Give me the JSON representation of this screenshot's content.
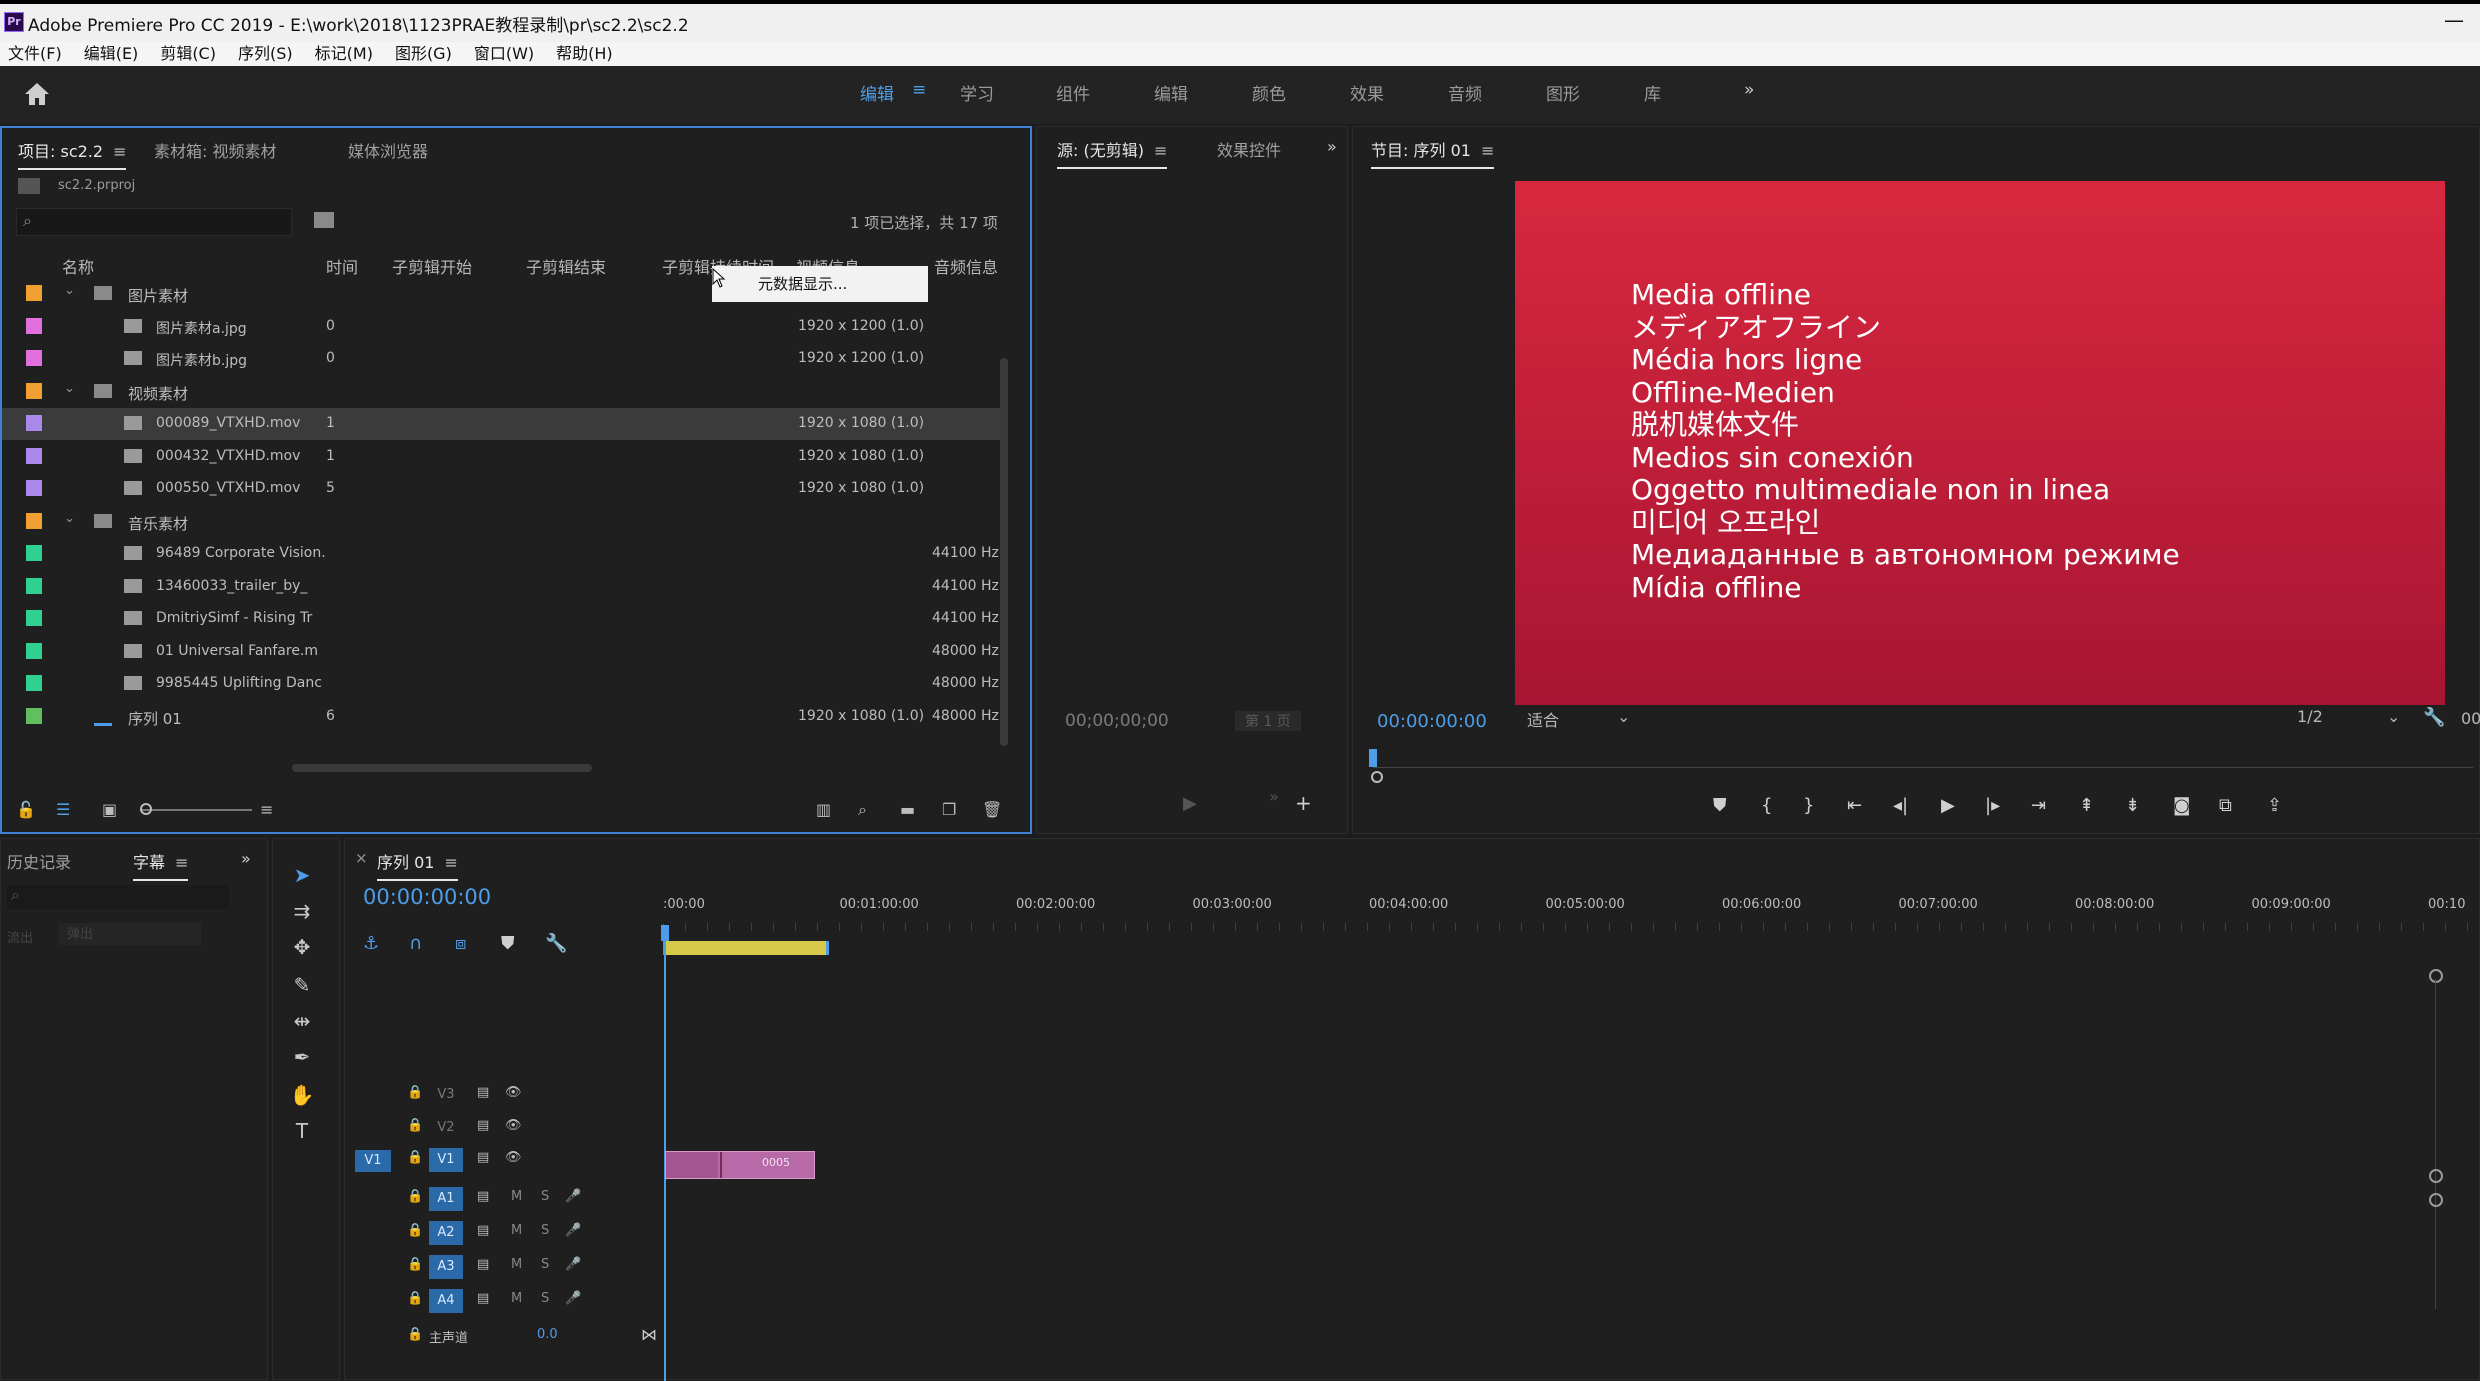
{
  "window": {
    "title": "Adobe Premiere Pro CC 2019 - E:\\work\\2018\\1123PRAE教程录制\\pr\\sc2.2\\sc2.2",
    "app_icon": "Pr"
  },
  "menu": [
    "文件(F)",
    "编辑(E)",
    "剪辑(C)",
    "序列(S)",
    "标记(M)",
    "图形(G)",
    "窗口(W)",
    "帮助(H)"
  ],
  "workspaces": [
    "编辑",
    "学习",
    "组件",
    "编辑",
    "颜色",
    "效果",
    "音频",
    "图形",
    "库"
  ],
  "project": {
    "tabs": [
      "项目: sc2.2",
      "素材箱: 视频素材",
      "媒体浏览器"
    ],
    "file": "sc2.2.prproj",
    "search_placeholder": "",
    "selection_count": "1 项已选择，共 17 项",
    "columns": [
      "名称",
      "时间",
      "子剪辑开始",
      "子剪辑结束",
      "子剪辑持续时间",
      "视频信息",
      "音频信息"
    ],
    "tooltip": "元数据显示...",
    "rows": [
      {
        "type": "folder",
        "name": "图片素材",
        "color": "#f0a030",
        "time": "",
        "video": "",
        "audio": ""
      },
      {
        "type": "file",
        "name": "图片素材a.jpg",
        "color": "#e070e0",
        "time": "0",
        "video": "1920 x 1200 (1.0)",
        "audio": ""
      },
      {
        "type": "file",
        "name": "图片素材b.jpg",
        "color": "#e070e0",
        "time": "0",
        "video": "1920 x 1200 (1.0)",
        "audio": ""
      },
      {
        "type": "folder",
        "name": "视频素材",
        "color": "#f0a030",
        "time": "",
        "video": "",
        "audio": ""
      },
      {
        "type": "file",
        "name": "000089_VTXHD.mov",
        "color": "#a888e8",
        "time": "1",
        "video": "1920 x 1080 (1.0)",
        "audio": "",
        "selected": true
      },
      {
        "type": "file",
        "name": "000432_VTXHD.mov",
        "color": "#a888e8",
        "time": "1",
        "video": "1920 x 1080 (1.0)",
        "audio": ""
      },
      {
        "type": "file",
        "name": "000550_VTXHD.mov",
        "color": "#a888e8",
        "time": "5",
        "video": "1920 x 1080 (1.0)",
        "audio": ""
      },
      {
        "type": "folder",
        "name": "音乐素材",
        "color": "#f0a030",
        "time": "",
        "video": "",
        "audio": ""
      },
      {
        "type": "file",
        "name": "96489 Corporate Vision.",
        "color": "#30d090",
        "time": "",
        "video": "",
        "audio": "44100 Hz"
      },
      {
        "type": "file",
        "name": "13460033_trailer_by_",
        "color": "#30d090",
        "time": "",
        "video": "",
        "audio": "44100 Hz"
      },
      {
        "type": "file",
        "name": "DmitriySimf - Rising Tr",
        "color": "#30d090",
        "time": "",
        "video": "",
        "audio": "44100 Hz"
      },
      {
        "type": "file",
        "name": "01 Universal Fanfare.m",
        "color": "#30d090",
        "time": "",
        "video": "",
        "audio": "48000 Hz"
      },
      {
        "type": "file",
        "name": "9985445 Uplifting Danc",
        "color": "#30d090",
        "time": "",
        "video": "",
        "audio": "48000 Hz"
      },
      {
        "type": "sequence",
        "name": "序列 01",
        "color": "#60c060",
        "time": "6",
        "video": "1920 x 1080 (1.0)",
        "audio": "48000 Hz"
      }
    ]
  },
  "source": {
    "tabs": [
      "源: (无剪辑)",
      "效果控件"
    ],
    "timecode": "00;00;00;00",
    "page": "第 1 页"
  },
  "program": {
    "tab": "节目: 序列 01",
    "offline_lines": [
      "Media offline",
      "メディアオフライン",
      "Média hors ligne",
      "Offline-Medien",
      "脱机媒体文件",
      "Medios sin conexión",
      "Oggetto multimediale non in linea",
      "미디어 오프라인",
      "Медиаданные в автономном режиме",
      "Mídia offline"
    ],
    "timecode": "00:00:00:00",
    "fit": "适合",
    "quality": "1/2",
    "end_time": "00"
  },
  "history": {
    "tabs": [
      "历史记录",
      "字幕"
    ],
    "dropdown": "弹出",
    "label": "流出"
  },
  "timeline": {
    "tab": "序列 01",
    "timecode": "00:00:00:00",
    "ruler": [
      ":00:00",
      "00:01:00:00",
      "00:02:00:00",
      "00:03:00:00",
      "00:04:00:00",
      "00:05:00:00",
      "00:06:00:00",
      "00:07:00:00",
      "00:08:00:00",
      "00:09:00:00",
      "00:10"
    ],
    "video_tracks": [
      "V3",
      "V2",
      "V1"
    ],
    "source_patch": "V1",
    "audio_tracks": [
      "A1",
      "A2",
      "A3",
      "A4"
    ],
    "master_label": "主声道",
    "master_value": "0.0",
    "clip_label": "0005"
  },
  "colors": {
    "accent": "#4e9de8",
    "panel_border_active": "#3f7fd6",
    "offline_bg": "#c8203a"
  }
}
